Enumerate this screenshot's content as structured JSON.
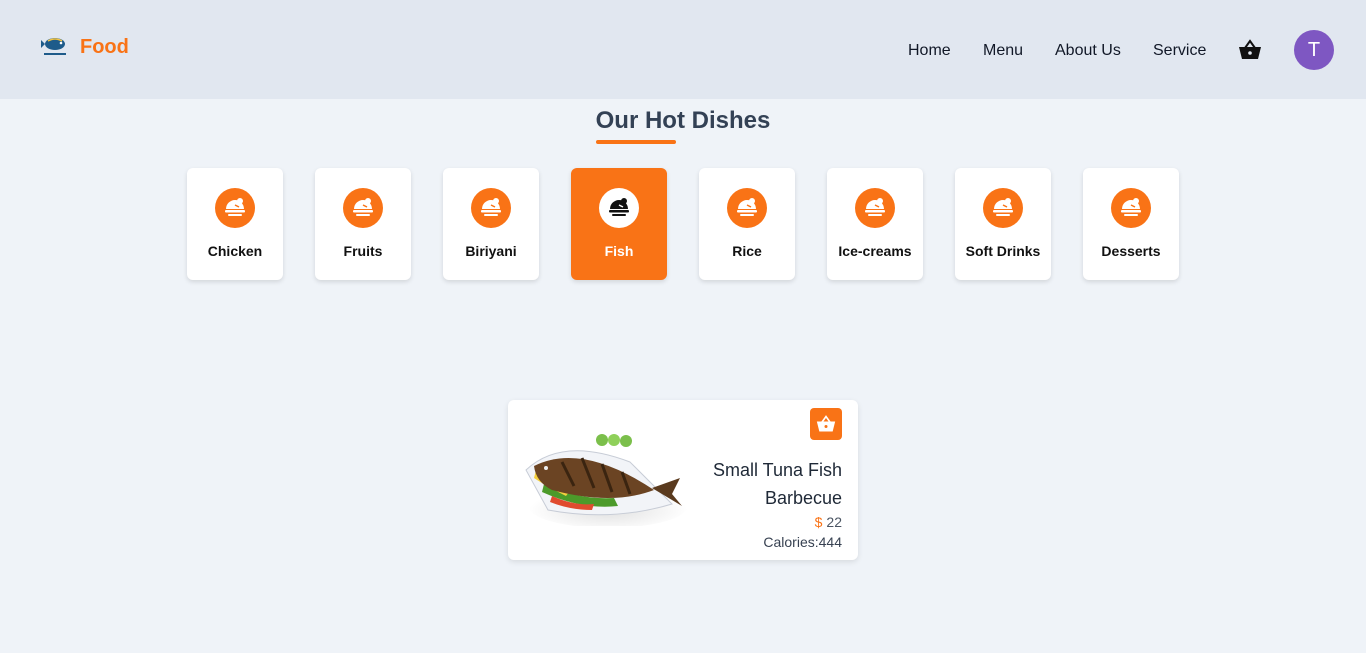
{
  "brand": {
    "name": "Food",
    "logo_icon": "fish-logo-icon"
  },
  "nav": {
    "items": [
      {
        "label": "Home"
      },
      {
        "label": "Menu"
      },
      {
        "label": "About Us"
      },
      {
        "label": "Service"
      }
    ],
    "cart_icon": "basket-icon",
    "avatar_initial": "T",
    "avatar_color": "#7e57c2"
  },
  "section": {
    "title": "Our Hot Dishes"
  },
  "categories": [
    {
      "label": "Chicken",
      "icon": "dish-icon",
      "active": false
    },
    {
      "label": "Fruits",
      "icon": "dish-icon",
      "active": false
    },
    {
      "label": "Biriyani",
      "icon": "dish-icon",
      "active": false
    },
    {
      "label": "Fish",
      "icon": "dish-icon",
      "active": true
    },
    {
      "label": "Rice",
      "icon": "dish-icon",
      "active": false
    },
    {
      "label": "Ice-creams",
      "icon": "dish-icon",
      "active": false
    },
    {
      "label": "Soft Drinks",
      "icon": "dish-icon",
      "active": false
    },
    {
      "label": "Desserts",
      "icon": "dish-icon",
      "active": false
    }
  ],
  "dish": {
    "name": "Small Tuna Fish Barbecue",
    "currency": "$",
    "price": "22",
    "calories": "Calories:444",
    "add_icon": "basket-icon"
  },
  "colors": {
    "accent": "#f97316",
    "header_bg": "#e1e7f0",
    "page_bg": "#eff3f8"
  }
}
